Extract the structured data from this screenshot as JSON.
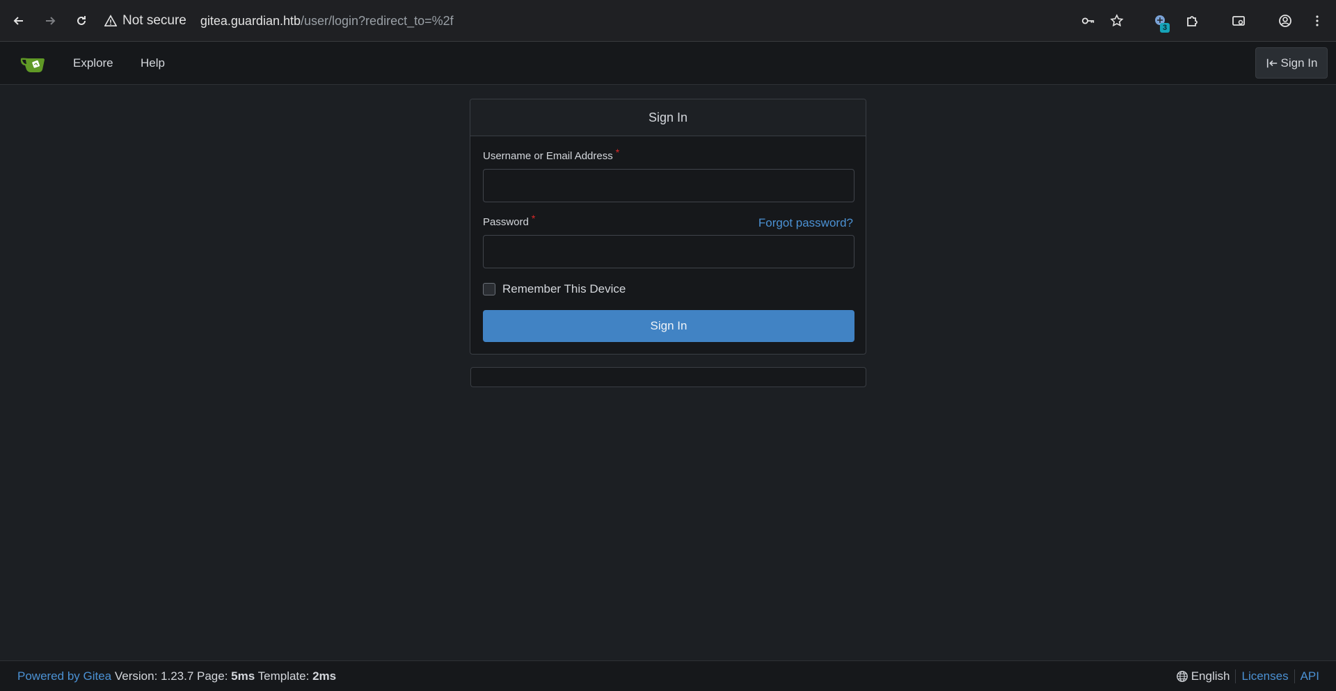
{
  "browser": {
    "security_text": "Not secure",
    "url_host": "gitea.guardian.htb",
    "url_path": "/user/login?redirect_to=%2f",
    "extension_badge": "3"
  },
  "nav": {
    "explore": "Explore",
    "help": "Help",
    "signin": "Sign In"
  },
  "login": {
    "title": "Sign In",
    "username_label": "Username or Email Address",
    "username_value": "",
    "password_label": "Password",
    "password_value": "",
    "required_mark": "*",
    "forgot": "Forgot password?",
    "remember": "Remember This Device",
    "submit": "Sign In"
  },
  "footer": {
    "powered_by": "Powered by Gitea",
    "version_text": "Version: 1.23.7 Page:",
    "page_time": "5ms",
    "template_label": "Template:",
    "template_time": "2ms",
    "language": "English",
    "licenses": "Licenses",
    "api": "API"
  },
  "colors": {
    "accent": "#4183c4",
    "link": "#4b91d3",
    "required": "#db2828",
    "background": "#1c1f23",
    "gitea_green": "#609926"
  }
}
